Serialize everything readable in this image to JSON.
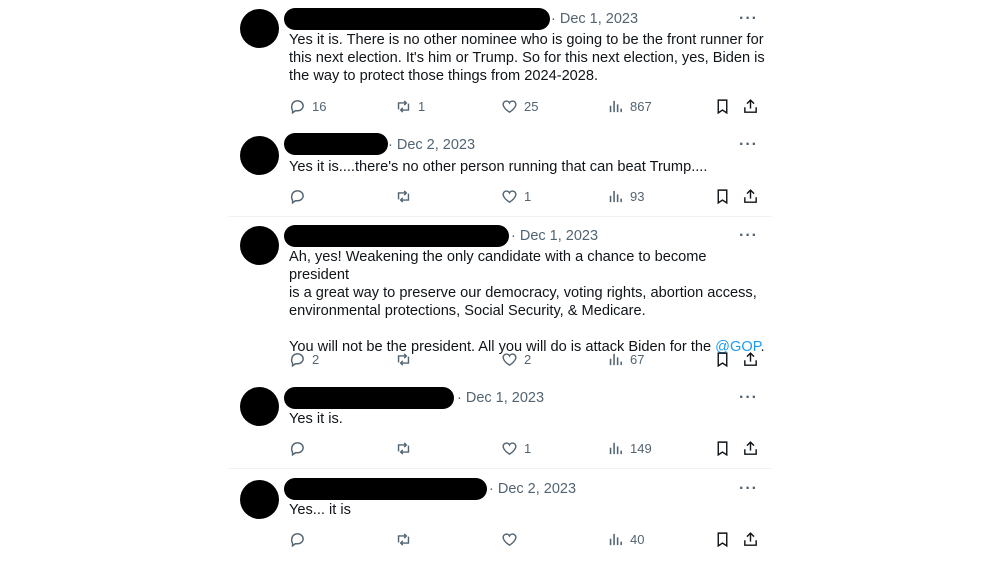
{
  "tweets": [
    {
      "date": "· Dec 1, 2023",
      "text": "Yes it is. There is no other nominee who is going to be the front runner for\nthis next election. It's him or Trump. So for this next election, yes, Biden is\nthe way to protect those things from 2024-2028.",
      "replies": "16",
      "reposts": "1",
      "likes": "25",
      "views": "867"
    },
    {
      "date": "· Dec 2, 2023",
      "text": "Yes it is....there's no other person running that can beat Trump....",
      "replies": "",
      "reposts": "",
      "likes": "1",
      "views": "93"
    },
    {
      "date": "· Dec 1, 2023",
      "text": "Ah, yes! Weakening the only candidate with a chance to become president\nis a great way to preserve our democracy, voting rights, abortion access,\nenvironmental protections, Social Security, & Medicare.\n\nYou will not be the president. All you will do is attack Biden for the ",
      "mention": "@GOP",
      "text_end": ".",
      "replies": "2",
      "reposts": "",
      "likes": "2",
      "views": "67"
    },
    {
      "date": "· Dec 1, 2023",
      "text": "Yes it is.",
      "replies": "",
      "reposts": "",
      "likes": "1",
      "views": "149"
    },
    {
      "date": "· Dec 2, 2023",
      "text": "Yes... it is",
      "replies": "",
      "reposts": "",
      "likes": "",
      "views": "40"
    }
  ],
  "icons": {
    "more": "more-icon",
    "reply": "reply-icon",
    "repost": "repost-icon",
    "like": "like-icon",
    "views": "views-icon",
    "bookmark": "bookmark-icon",
    "share": "share-icon"
  },
  "colors": {
    "text": "#0f1419",
    "secondary": "#536471",
    "link": "#1d9bf0",
    "redaction": "#000000"
  }
}
